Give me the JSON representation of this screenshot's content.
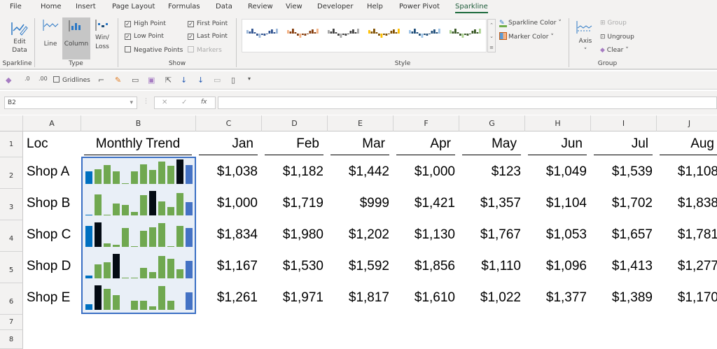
{
  "tabs": [
    "File",
    "Home",
    "Insert",
    "Page Layout",
    "Formulas",
    "Data",
    "Review",
    "View",
    "Developer",
    "Help",
    "Power Pivot",
    "Sparkline"
  ],
  "active_tab": "Sparkline",
  "ribbon": {
    "sparkline_group": {
      "edit_data": "Edit Data",
      "label": "Sparkline"
    },
    "type_group": {
      "line": "Line",
      "column": "Column",
      "winloss": "Win/ Loss",
      "label": "Type",
      "selected": "Column"
    },
    "show_group": {
      "high_point": "High Point",
      "low_point": "Low Point",
      "negative_points": "Negative Points",
      "first_point": "First Point",
      "last_point": "Last Point",
      "markers": "Markers",
      "label": "Show",
      "checked": {
        "high_point": true,
        "low_point": true,
        "negative_points": false,
        "first_point": true,
        "last_point": true,
        "markers": false
      }
    },
    "style_group": {
      "label": "Style",
      "sparkline_color": "Sparkline Color",
      "marker_color": "Marker Color",
      "gallery": [
        [
          "#9bb7d9",
          "#2f528f"
        ],
        [
          "#f4b183",
          "#843c0c"
        ],
        [
          "#a5a5a5",
          "#404040"
        ],
        [
          "#ffc000",
          "#7f4f00"
        ],
        [
          "#9dc3e6",
          "#1f4e79"
        ],
        [
          "#a9d18e",
          "#375623"
        ]
      ]
    },
    "group_group": {
      "axis": "Axis",
      "group": "Group",
      "ungroup": "Ungroup",
      "clear": "Clear",
      "label": "Group"
    }
  },
  "qat": {
    "gridlines": "Gridlines"
  },
  "formula_bar": {
    "name_box": "B2",
    "fx": "fx",
    "value": ""
  },
  "columns": [
    "A",
    "B",
    "C",
    "D",
    "E",
    "F",
    "G",
    "H",
    "I",
    "J"
  ],
  "rows": [
    "1",
    "2",
    "3",
    "4",
    "5",
    "6",
    "7",
    "8"
  ],
  "header_row": [
    "Loc",
    "Monthly Trend",
    "Jan",
    "Feb",
    "Mar",
    "Apr",
    "May",
    "Jun",
    "Jul",
    "Aug"
  ],
  "data_rows": [
    {
      "loc": "Shop A",
      "values": [
        "$1,038",
        "$1,182",
        "$1,442",
        "$1,000",
        "$123",
        "$1,049",
        "$1,539",
        "$1,108"
      ]
    },
    {
      "loc": "Shop B",
      "values": [
        "$1,000",
        "$1,719",
        "$999",
        "$1,421",
        "$1,357",
        "$1,104",
        "$1,702",
        "$1,838"
      ]
    },
    {
      "loc": "Shop C",
      "values": [
        "$1,834",
        "$1,980",
        "$1,202",
        "$1,130",
        "$1,767",
        "$1,053",
        "$1,657",
        "$1,781"
      ]
    },
    {
      "loc": "Shop D",
      "values": [
        "$1,167",
        "$1,530",
        "$1,592",
        "$1,856",
        "$1,110",
        "$1,096",
        "$1,413",
        "$1,277"
      ]
    },
    {
      "loc": "Shop E",
      "values": [
        "$1,261",
        "$1,971",
        "$1,817",
        "$1,610",
        "$1,022",
        "$1,377",
        "$1,389",
        "$1,170"
      ]
    }
  ],
  "sparkline_levels": [
    [
      0.51,
      0.6,
      0.77,
      0.51,
      0.03,
      0.51,
      0.8,
      0.57,
      0.91,
      0.74,
      1,
      0.77
    ],
    [
      0.03,
      0.86,
      0.03,
      0.5,
      0.44,
      0.14,
      0.83,
      1,
      0.56,
      0.33,
      0.92,
      0.53
    ],
    [
      0.86,
      1,
      0.14,
      0.09,
      0.77,
      0.03,
      0.66,
      0.8,
      0.97,
      0.03,
      0.86,
      0.77
    ],
    [
      0.11,
      0.56,
      0.67,
      1,
      0.03,
      0.03,
      0.44,
      0.25,
      0.92,
      0.81,
      0.36,
      0.72
    ],
    [
      0.23,
      1,
      0.86,
      0.6,
      0,
      0.37,
      0.37,
      0.14,
      0.97,
      0.37,
      0,
      0.71
    ]
  ],
  "sparkline_colors": {
    "series": "#70a850",
    "high": "#040b14",
    "first": "#0070c0",
    "last": "#4472c4"
  }
}
